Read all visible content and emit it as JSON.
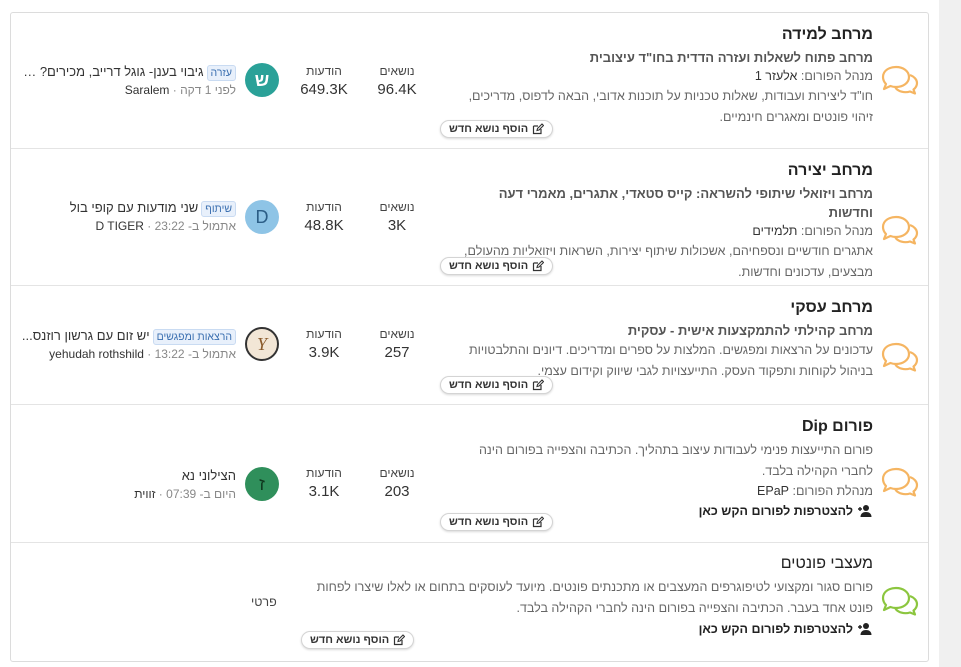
{
  "forums": [
    {
      "title": "מרחב למידה",
      "subtitle": "מרחב פתוח לשאלות ועזרה הדדית בחו\"ד עיצובית",
      "moderator_label": "מנהל הפורום:",
      "moderator": "אלעזר 1",
      "description": "חו\"ד ליצירות ועבודות, שאלות טכניות על תוכנות אדובי, הבאה לדפוס, מדריכים, זיהוי פונטים ומאגרים חינמיים.",
      "new_topic": "הוסף נושא חדש",
      "topics_label": "נושאים",
      "topics": "96.4K",
      "posts_label": "הודעות",
      "posts": "649.3K",
      "avatar_letter": "ש",
      "last_post_tag": "עזרה",
      "last_post_title": "גיבוי בענן- גוגל דרייב, מכירים? א...",
      "last_post_time": "לפני 1 דקה",
      "last_post_author": "Saralem",
      "icon_color": "#f5b562",
      "avatar_color": "#2aa198"
    },
    {
      "title": "מרחב יצירה",
      "subtitle": "מרחב ויזואלי שיתופי להשראה: קייס סטאדי, אתגרים, מאמרי דעה וחדשות",
      "moderator_label": "מנהל הפורום:",
      "moderator": "תלמידים",
      "description": "אתגרים חודשיים ונספחיהם, אשכולות שיתוף יצירות, השראות ויזואליות מהעולם, מבצעים, עדכונים וחדשות.",
      "new_topic": "הוסף נושא חדש",
      "topics_label": "נושאים",
      "topics": "3K",
      "posts_label": "הודעות",
      "posts": "48.8K",
      "avatar_letter": "D",
      "last_post_tag": "שיתוף",
      "last_post_title": "שני מודעות עם קופי בול",
      "last_post_time": "אתמול ב- 23:22",
      "last_post_author": "D TIGER",
      "icon_color": "#f5b562",
      "avatar_color": "#8ec4e6"
    },
    {
      "title": "מרחב עסקי",
      "subtitle": "מרחב קהילתי להתמקצעות אישית - עסקית",
      "description": "עדכונים על הרצאות ומפגשים. המלצות על ספרים ומדריכים. דיונים והתלבטויות בניהול לקוחות ותפקוד העסק. התייעצויות לגבי שיווק וקידום עצמי.",
      "new_topic": "הוסף נושא חדש",
      "topics_label": "נושאים",
      "topics": "257",
      "posts_label": "הודעות",
      "posts": "3.9K",
      "avatar_letter": "Y",
      "last_post_tag": "הרצאות ומפגשים",
      "last_post_title": "יש זום עם גרשון רוזנס...",
      "last_post_time": "אתמול ב- 13:22",
      "last_post_author": "yehudah rothshild",
      "icon_color": "#f5b562",
      "avatar_color": "#f2e6d6"
    },
    {
      "title": "פורום Dip",
      "description": "פורום התייעצות פנימי לעבודות עיצוב בתהליך. הכתיבה והצפייה בפורום הינה לחברי הקהילה בלבד.",
      "moderator_label": "מנהלת הפורום:",
      "moderator": "EPaP",
      "join": "להצטרפות לפורום הקש כאן",
      "new_topic": "הוסף נושא חדש",
      "topics_label": "נושאים",
      "topics": "203",
      "posts_label": "הודעות",
      "posts": "3.1K",
      "avatar_letter": "ז",
      "last_post_title": "הצילוני נא",
      "last_post_time": "היום ב- 07:39",
      "last_post_author": "זווית",
      "icon_color": "#f5b562",
      "avatar_color": "#2f8f5b"
    },
    {
      "title": "מעצבי פונטים",
      "description": "פורום סגור ומקצועי לטיפוגרפים המעצבים או מתכנתים פונטים. מיועד לעוסקים בתחום או לאלו שיצרו לפחות פונט אחד בעבר. הכתיבה והצפייה בפורום הינה לחברי הקהילה בלבד.",
      "join": "להצטרפות לפורום הקש כאן",
      "new_topic": "הוסף נושא חדש",
      "private_label": "פרטי",
      "icon_color": "#8cc63f"
    }
  ]
}
